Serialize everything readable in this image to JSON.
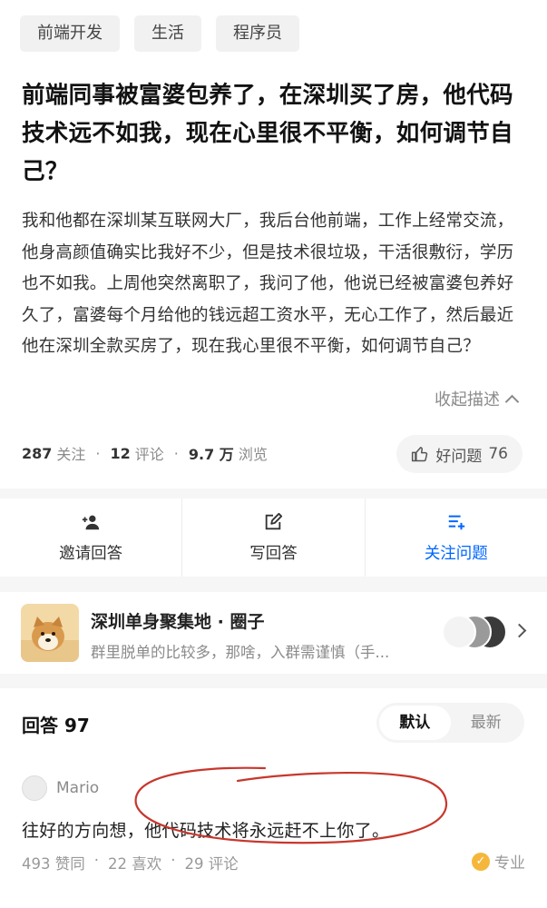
{
  "tags": [
    "前端开发",
    "生活",
    "程序员"
  ],
  "question": {
    "title": "前端同事被富婆包养了，在深圳买了房，他代码技术远不如我，现在心里很不平衡，如何调节自己？",
    "description": "我和他都在深圳某互联网大厂，我后台他前端，工作上经常交流，他身高颜值确实比我好不少，但是技术很垃圾，干活很敷衍，学历也不如我。上周他突然离职了，我问了他，他说已经被富婆包养好久了，富婆每个月给他的钱远超工资水平，无心工作了，然后最近他在深圳全款买房了，现在我心里很不平衡，如何调节自己？",
    "collapse_label": "收起描述"
  },
  "stats": {
    "followers": "287",
    "followers_label": "关注",
    "comments": "12",
    "comments_label": "评论",
    "views": "9.7 万",
    "views_label": "浏览",
    "good_label": "好问题",
    "good_count": "76"
  },
  "actions": {
    "invite": "邀请回答",
    "write": "写回答",
    "follow": "关注问题"
  },
  "circle": {
    "name": "深圳单身聚集地 · 圈子",
    "subtitle": "群里脱单的比较多，那啥，入群需谨慎（手..."
  },
  "answers": {
    "count_label": "回答 97",
    "sort_default": "默认",
    "sort_latest": "最新",
    "items": [
      {
        "author": "Mario",
        "text": "往好的方向想，他代码技术将永远赶不上你了。",
        "likes": "493 赞同",
        "favorites": "22 喜欢",
        "comments": "29 评论",
        "badge": "专业"
      }
    ]
  },
  "colors": {
    "accent": "#0066ff",
    "annotation": "#c8372d",
    "badge": "#f5b73b"
  }
}
